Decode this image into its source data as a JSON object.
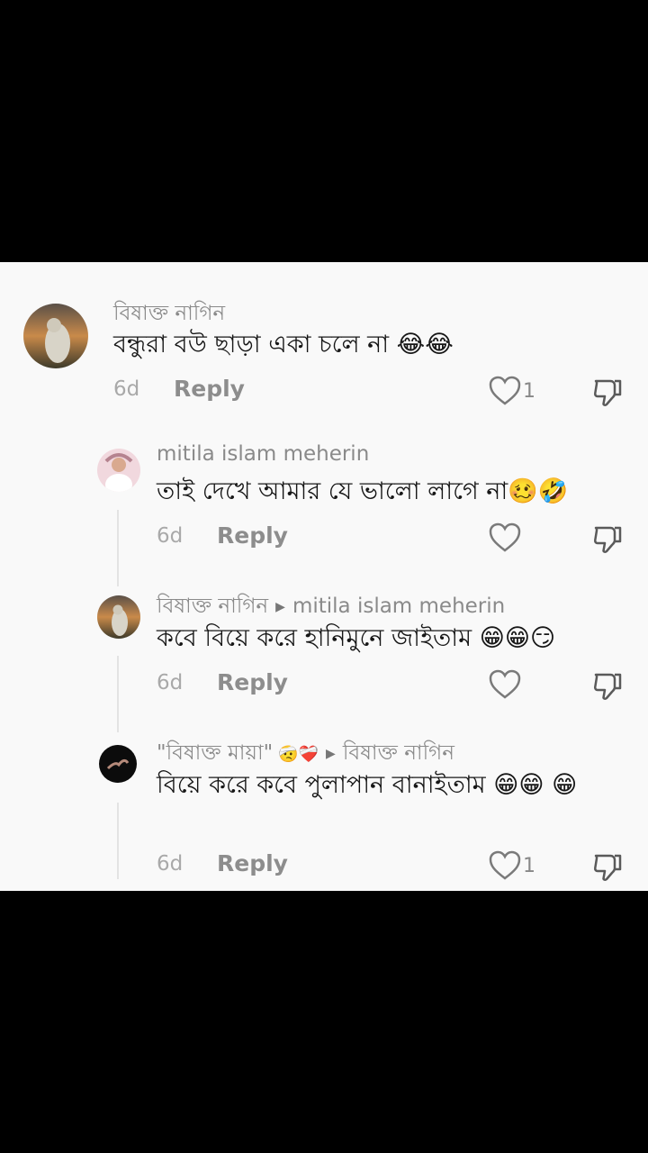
{
  "comments": [
    {
      "author": "বিষাক্ত নাগিন",
      "text": "বন্ধুরা বউ ছাড়া একা চলে না 😂😂",
      "time": "6d",
      "reply": "Reply",
      "likes": "1"
    },
    {
      "author": "mitila islam meherin",
      "text": "তাই দেখে আমার যে ভালো লাগে না🥴🤣",
      "time": "6d",
      "reply": "Reply",
      "likes": ""
    },
    {
      "author": "বিষাক্ত নাগিন",
      "reply_to": "mitila islam meherin",
      "text": "কবে বিয়ে করে হানিমুনে জাইতাম 😁😁😏",
      "time": "6d",
      "reply": "Reply",
      "likes": ""
    },
    {
      "author": "\"বিষাক্ত মায়া\"",
      "author_emoji": "🤕❤️‍🩹",
      "reply_to": "বিষাক্ত নাগিন",
      "text": "বিয়ে করে কবে পুলাপান বানাইতাম 😁😁 😁",
      "time": "6d",
      "reply": "Reply",
      "likes": "1"
    }
  ],
  "icons": {
    "like": "heart-outline-icon",
    "dislike": "thumbs-down-icon",
    "reply_to": "caret-right-icon"
  },
  "colors": {
    "background": "#f9f9f9",
    "letterbox": "#000000",
    "username": "#8a8a8a",
    "text": "#161616"
  }
}
